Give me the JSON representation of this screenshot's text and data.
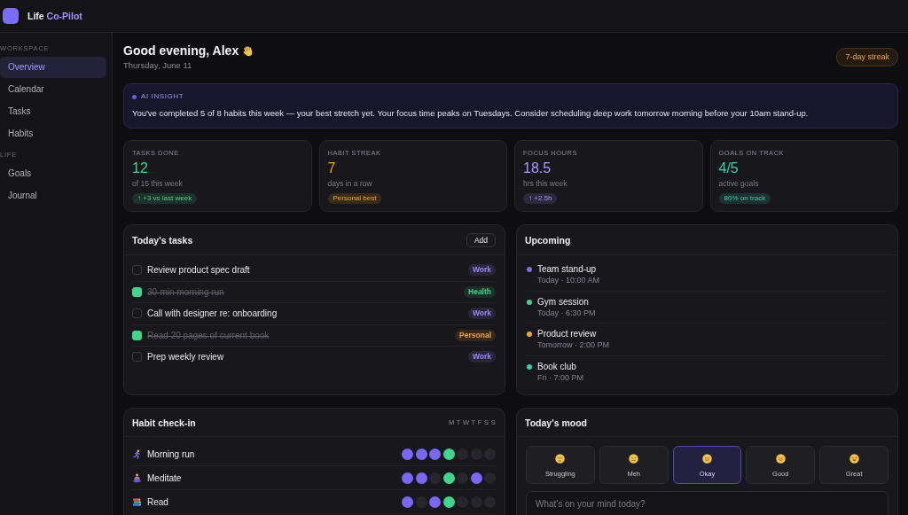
{
  "brand": {
    "name": "Life",
    "accent": "Co-Pilot"
  },
  "sidebar": {
    "sections": [
      {
        "label": "WORKSPACE",
        "items": [
          {
            "label": "Overview",
            "selected": true
          },
          {
            "label": "Calendar",
            "selected": false
          },
          {
            "label": "Tasks",
            "selected": false
          },
          {
            "label": "Habits",
            "selected": false
          }
        ]
      },
      {
        "label": "LIFE",
        "items": [
          {
            "label": "Goals",
            "selected": false
          },
          {
            "label": "Journal",
            "selected": false
          }
        ]
      }
    ]
  },
  "header": {
    "greeting": "Good evening, Alex",
    "date": "Thursday, June 11",
    "streak": "7-day streak"
  },
  "insight": {
    "label": "AI INSIGHT",
    "text": "You've completed 5 of 8 habits this week — your best stretch yet. Your focus time peaks on Tuesdays. Consider scheduling deep work tomorrow morning before your 10am stand-up."
  },
  "stats": [
    {
      "label": "TASKS DONE",
      "value": "12",
      "caption": "of 15 this week",
      "tag": "↑ +3 vs last week",
      "color": "#3dd68c"
    },
    {
      "label": "HABIT STREAK",
      "value": "7",
      "caption": "days in a row",
      "tag": "Personal best",
      "color": "#f5a524"
    },
    {
      "label": "FOCUS HOURS",
      "value": "18.5",
      "caption": "hrs this week",
      "tag": "↑ +2.5h",
      "color": "#a898ff"
    },
    {
      "label": "GOALS ON TRACK",
      "value": "4/5",
      "caption": "active goals",
      "tag": "80% on track",
      "color": "#2fd3b0"
    }
  ],
  "tasks": {
    "title": "Today's tasks",
    "add": "Add",
    "items": [
      {
        "text": "Review product spec draft",
        "checked": false,
        "tag": "Work",
        "color": "#9b8afb"
      },
      {
        "text": "30-min morning run",
        "checked": true,
        "tag": "Health",
        "color": "#3dd68c"
      },
      {
        "text": "Call with designer re: onboarding",
        "checked": false,
        "tag": "Work",
        "color": "#9b8afb"
      },
      {
        "text": "Read 20 pages of current book",
        "checked": true,
        "tag": "Personal",
        "color": "#f0a030"
      },
      {
        "text": "Prep weekly review",
        "checked": false,
        "tag": "Work",
        "color": "#9b8afb"
      }
    ]
  },
  "upcoming": {
    "title": "Upcoming",
    "items": [
      {
        "title": "Team stand-up",
        "when": "Today · 10:00 AM",
        "color": "#7c6cf2"
      },
      {
        "title": "Gym session",
        "when": "Today · 6:30 PM",
        "color": "#3dd68c"
      },
      {
        "title": "Product review",
        "when": "Tomorrow · 2:00 PM",
        "color": "#f5a524"
      },
      {
        "title": "Book club",
        "when": "Fri · 7:00 PM",
        "color": "#2fd3b0"
      }
    ]
  },
  "habits": {
    "title": "Habit check-in",
    "weekdays": "M T W T F S S",
    "items": [
      {
        "name": "Morning run",
        "kind": "exercise",
        "days": [
          {
            "checked": true,
            "today": false
          },
          {
            "checked": true,
            "today": false
          },
          {
            "checked": true,
            "today": false
          },
          {
            "checked": true,
            "today": true
          },
          {
            "checked": false,
            "today": false
          },
          {
            "checked": false,
            "today": false
          },
          {
            "checked": false,
            "today": false
          }
        ]
      },
      {
        "name": "Meditate",
        "kind": "mindfulness",
        "days": [
          {
            "checked": true,
            "today": false
          },
          {
            "checked": true,
            "today": false
          },
          {
            "checked": false,
            "today": false
          },
          {
            "checked": true,
            "today": true
          },
          {
            "checked": false,
            "today": false
          },
          {
            "checked": true,
            "today": false
          },
          {
            "checked": false,
            "today": false
          }
        ]
      },
      {
        "name": "Read",
        "kind": "reading",
        "days": [
          {
            "checked": true,
            "today": false
          },
          {
            "checked": false,
            "today": false
          },
          {
            "checked": true,
            "today": false
          },
          {
            "checked": true,
            "today": true
          },
          {
            "checked": false,
            "today": false
          },
          {
            "checked": false,
            "today": false
          },
          {
            "checked": false,
            "today": false
          }
        ]
      }
    ]
  },
  "mood": {
    "title": "Today's mood",
    "options": [
      {
        "label": "Struggling",
        "kind": "low",
        "selected": false
      },
      {
        "label": "Meh",
        "kind": "flat",
        "selected": false
      },
      {
        "label": "Okay",
        "kind": "neutral",
        "selected": true
      },
      {
        "label": "Good",
        "kind": "happy",
        "selected": false
      },
      {
        "label": "Great",
        "kind": "excited",
        "selected": false
      }
    ],
    "note": {
      "placeholder": "What's on your mind today?"
    }
  }
}
